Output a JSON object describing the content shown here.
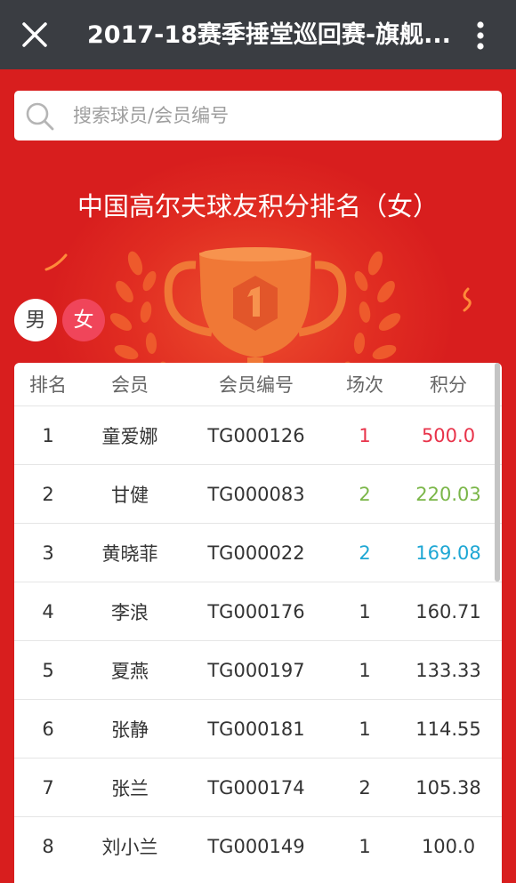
{
  "topbar": {
    "title": "2017-18赛季捶堂巡回赛-旗舰...",
    "close_icon": "close-icon",
    "more_icon": "more-vertical-icon"
  },
  "search": {
    "placeholder": "搜索球员/会员编号",
    "icon": "search-icon"
  },
  "heading": "中国高尔夫球友积分排名（女）",
  "gender_tabs": [
    {
      "label": "男",
      "selected": false
    },
    {
      "label": "女",
      "selected": true
    }
  ],
  "table": {
    "headers": [
      "排名",
      "会员",
      "会员编号",
      "场次",
      "积分"
    ],
    "rows": [
      {
        "rank": "1",
        "name": "童爱娜",
        "member_id": "TG000126",
        "games": "1",
        "score": "500.0",
        "color": "#e8334a"
      },
      {
        "rank": "2",
        "name": "甘健",
        "member_id": "TG000083",
        "games": "2",
        "score": "220.03",
        "color": "#7ab648"
      },
      {
        "rank": "3",
        "name": "黄晓菲",
        "member_id": "TG000022",
        "games": "2",
        "score": "169.08",
        "color": "#1ea7d4"
      },
      {
        "rank": "4",
        "name": "李浪",
        "member_id": "TG000176",
        "games": "1",
        "score": "160.71",
        "color": "#333333"
      },
      {
        "rank": "5",
        "name": "夏燕",
        "member_id": "TG000197",
        "games": "1",
        "score": "133.33",
        "color": "#333333"
      },
      {
        "rank": "6",
        "name": "张静",
        "member_id": "TG000181",
        "games": "1",
        "score": "114.55",
        "color": "#333333"
      },
      {
        "rank": "7",
        "name": "张兰",
        "member_id": "TG000174",
        "games": "2",
        "score": "105.38",
        "color": "#333333"
      },
      {
        "rank": "8",
        "name": "刘小兰",
        "member_id": "TG000149",
        "games": "1",
        "score": "100.0",
        "color": "#333333"
      }
    ]
  },
  "colors": {
    "background": "#d81e1e",
    "topbar": "#3a3d42",
    "female_tab": "#f0455a"
  }
}
